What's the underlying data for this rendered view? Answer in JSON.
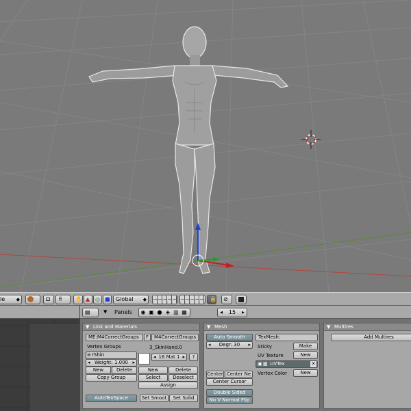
{
  "toolbar": {
    "mode_trunc": "le",
    "orientation": "Global"
  },
  "buttons_header": {
    "panels_label": "Panels",
    "frame": "15"
  },
  "link_materials": {
    "title": "Link and Materials",
    "me_name": "ME:M4CorrectGroups",
    "f_label": "F",
    "ob_name": "M4CorrectGroups",
    "vertex_groups_label": "Vertex Groups",
    "group_name": "rShin",
    "weight": "Weight: 1.000",
    "new": "New",
    "delete": "Delete",
    "copy_group": "Copy Group",
    "material_name": "3_SkinHand.0",
    "mat_index": "16 Mat 1",
    "question": "?",
    "mat_new": "New",
    "mat_delete": "Delete",
    "select": "Select",
    "deselect": "Deselect",
    "assign": "Assign",
    "autotexspace": "AutoTexSpace",
    "set_smooth": "Set Smoot",
    "set_solid": "Set Solid"
  },
  "mesh": {
    "title": "Mesh",
    "auto_smooth": "Auto Smooth",
    "degr": "Degr: 30",
    "texmesh": "TexMesh:",
    "sticky": "Sticky",
    "make": "Make",
    "uv_texture": "UV Texture",
    "uv_new": "New",
    "uvtex": "UVTex",
    "vertex_color": "Vertex Color",
    "vc_new": "New",
    "center": "Center",
    "center_new": "Center Ne",
    "center_cursor": "Center Cursor",
    "double_sided": "Double Sided",
    "no_v_normal_flip": "No V Normal Flip"
  },
  "multires": {
    "title": "Multires",
    "add_multires": "Add Multires"
  },
  "colors": {
    "viewport_bg": "#7a7a7a",
    "grid": "#8a8a8a",
    "x_axis": "#b0463e",
    "y_axis": "#5a8a3a",
    "z_axis": "#2040d0"
  }
}
